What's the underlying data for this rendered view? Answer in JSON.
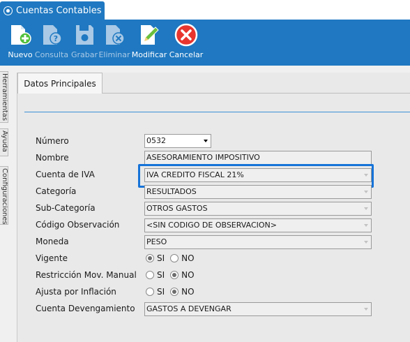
{
  "window_tab": {
    "title": "Cuentas Contables"
  },
  "toolbar": {
    "nuevo": "Nuevo",
    "consulta": "Consulta",
    "grabar": "Grabar",
    "eliminar": "Eliminar",
    "modificar": "Modificar",
    "cancelar": "Cancelar"
  },
  "side_tabs": [
    "Herramientas",
    "Ayuda",
    "Configuraciones"
  ],
  "panel_tab": "Datos Principales",
  "form": {
    "numero": {
      "label": "Número",
      "value": "0532"
    },
    "nombre": {
      "label": "Nombre",
      "value": "ASESORAMIENTO IMPOSITIVO"
    },
    "cuenta_iva": {
      "label": "Cuenta de IVA",
      "value": "IVA CREDITO FISCAL 21%"
    },
    "categoria": {
      "label": "Categoría",
      "value": "RESULTADOS"
    },
    "sub_categoria": {
      "label": "Sub-Categoría",
      "value": "OTROS GASTOS"
    },
    "codigo_obs": {
      "label": "Código Observación",
      "value": "<SIN CODIGO DE OBSERVACION>"
    },
    "moneda": {
      "label": "Moneda",
      "value": "PESO"
    },
    "vigente": {
      "label": "Vigente",
      "si": "SI",
      "no": "NO",
      "selected": "SI"
    },
    "restriccion": {
      "label": "Restricción Mov. Manual",
      "si": "SI",
      "no": "NO",
      "selected": "NO"
    },
    "ajusta": {
      "label": "Ajusta por Inflación",
      "si": "SI",
      "no": "NO",
      "selected": "NO"
    },
    "devengamiento": {
      "label": "Cuenta Devengamiento",
      "value": "GASTOS A DEVENGAR"
    }
  },
  "colors": {
    "ribbon": "#1f78c1",
    "highlight": "#1673d8",
    "cancel_red": "#e8352e"
  }
}
